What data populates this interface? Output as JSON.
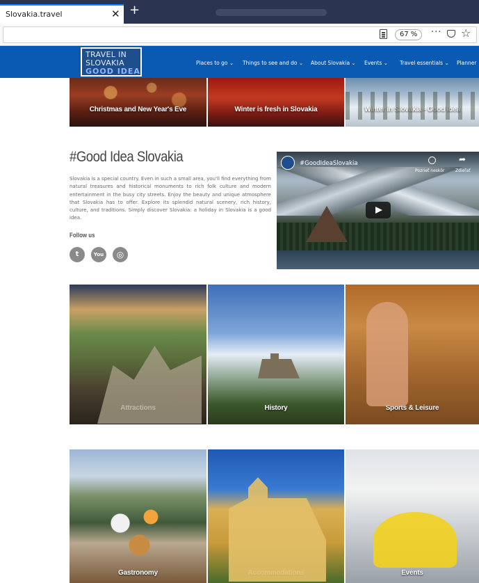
{
  "browser": {
    "tab_title": "Slovakia.travel",
    "close_symbol": "✕",
    "newtab_symbol": "+",
    "zoom": "67 %",
    "more_symbol": "···",
    "star_symbol": "☆"
  },
  "site": {
    "logo": {
      "line1": "TRAVEL IN",
      "line2": "SLOVAKIA",
      "line3": "GOOD IDEA"
    },
    "nav": [
      "Places to go ⌄",
      "Things to see and do ⌄",
      "About Slovakia ⌄",
      "Events ⌄",
      "Travel essentials ⌄",
      "Planner"
    ]
  },
  "top_tiles": [
    {
      "label": "Christmas and New Year's Eve"
    },
    {
      "label": "Winter is fresh in Slovakia"
    },
    {
      "label": "Winter in Slovakia - Good Idea"
    }
  ],
  "intro": {
    "heading": "#Good Idea Slovakia",
    "text": "Slovakia is a special country. Even in such a small area, you'll find everything from natural treasures and historical monuments to rich folk culture and modern entertainment in the busy city streets. Enjoy the beauty and unique atmosphere that Slovakia has to offer. Explore its splendid natural scenery, rich history, culture, and traditions. Simply discover Slovakia: a holiday in Slovakia is a good idea.",
    "follow_label": "Follow us",
    "social": [
      "twitter-icon",
      "youtube-icon",
      "instagram-icon"
    ],
    "social_glyphs": [
      "t",
      "You",
      "◎"
    ]
  },
  "video": {
    "title": "#GoodIdeaSlovakia",
    "watch_later": "Pozrieť neskôr",
    "share": "Zdieľať",
    "share_symbol": "➦"
  },
  "category_tiles_row1": [
    {
      "label": "Attractions"
    },
    {
      "label": "History"
    },
    {
      "label": "Sports & Leisure"
    }
  ],
  "category_tiles_row2": [
    {
      "label": "Gastronomy"
    },
    {
      "label": "Accommodations"
    },
    {
      "label": "Events"
    }
  ]
}
